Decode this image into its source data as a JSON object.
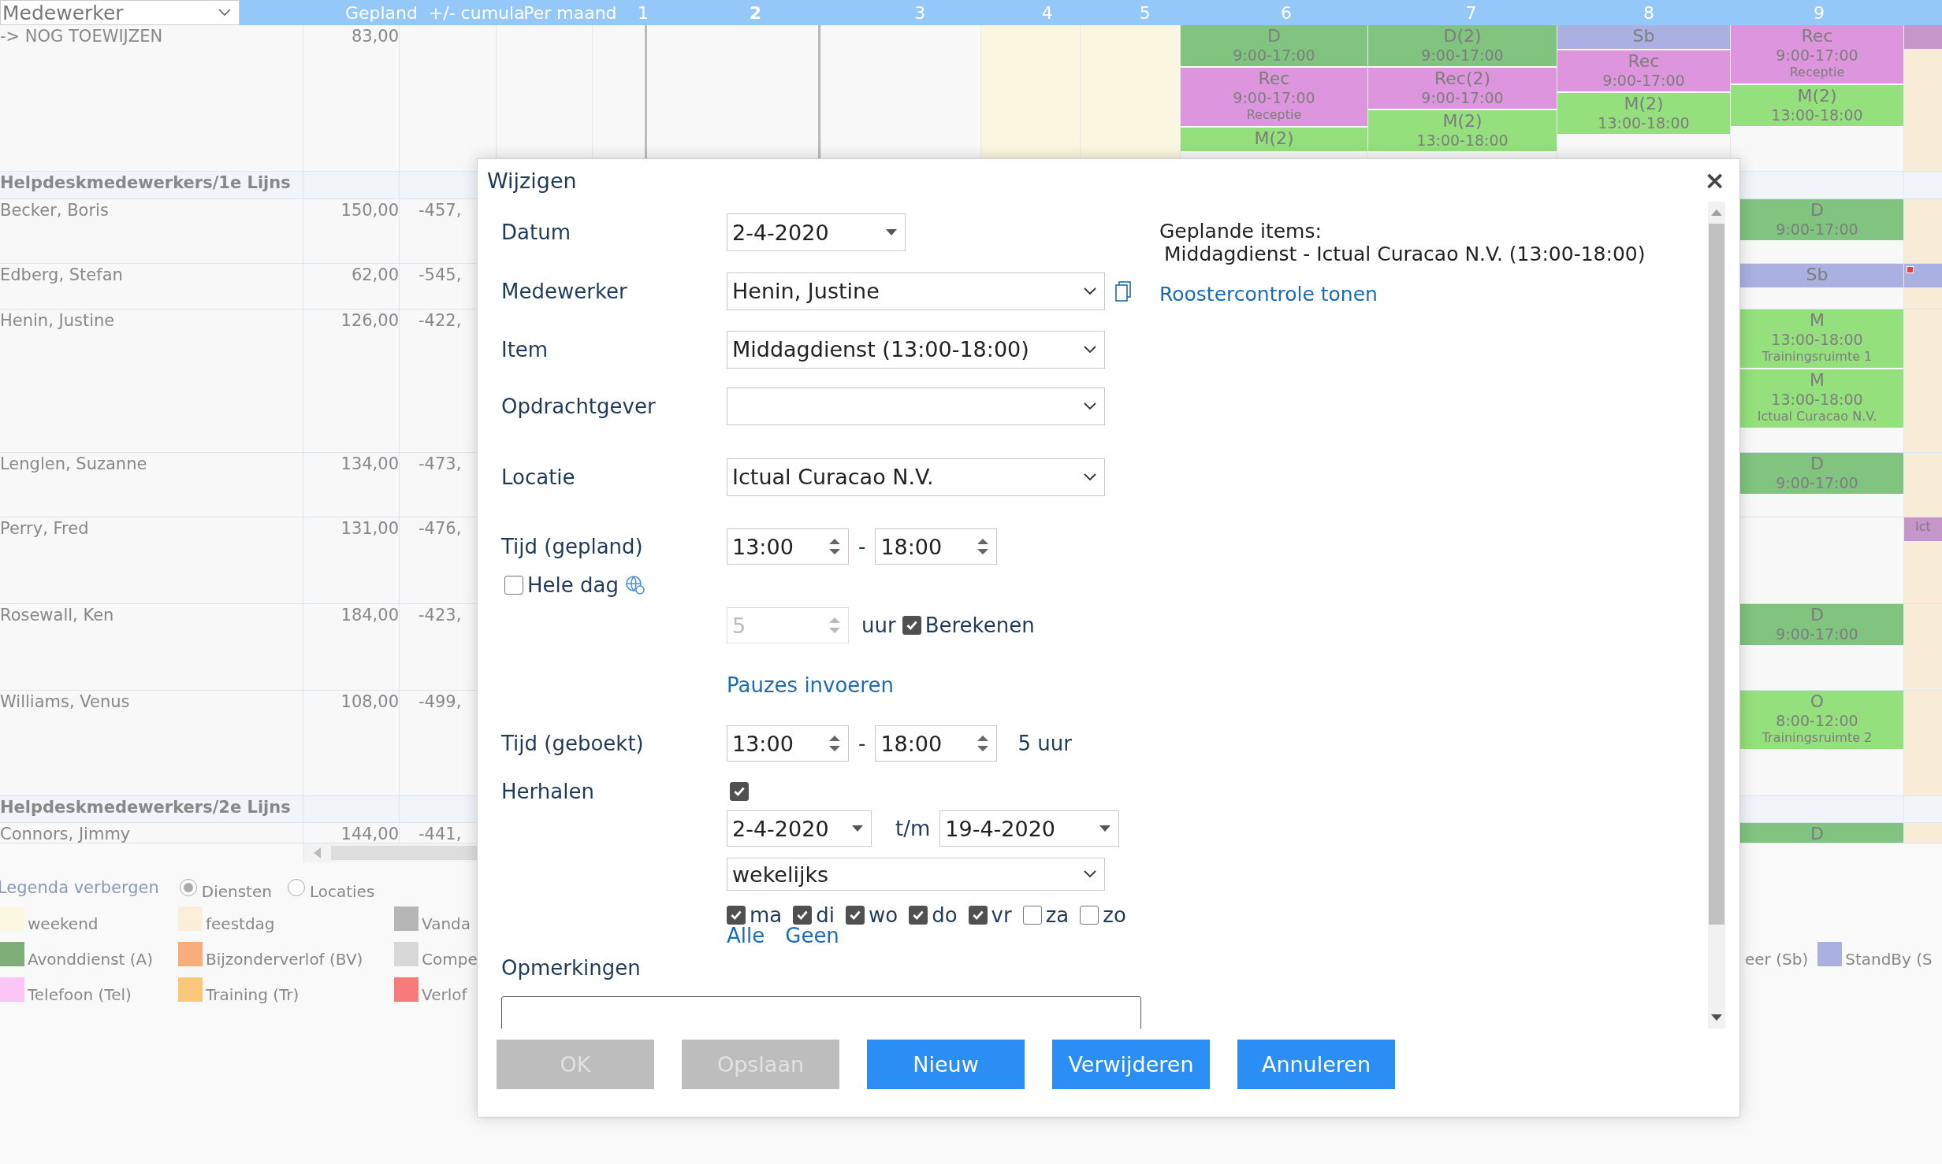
{
  "grid": {
    "employee_select": "Medewerker",
    "columns": [
      "Gepland",
      "+/- cumula",
      "Per maand"
    ],
    "days": [
      {
        "label": "1",
        "kind": "normal"
      },
      {
        "label": "2",
        "kind": "today"
      },
      {
        "label": "3",
        "kind": "normal"
      },
      {
        "label": "4",
        "kind": "weekend"
      },
      {
        "label": "5",
        "kind": "weekend"
      },
      {
        "label": "6",
        "kind": "normal"
      },
      {
        "label": "7",
        "kind": "normal"
      },
      {
        "label": "8",
        "kind": "normal"
      },
      {
        "label": "9",
        "kind": "normal"
      },
      {
        "kind": "holiday"
      }
    ],
    "rows": [
      {
        "kind": "employee",
        "name": "-> NOG TOEWIJZEN",
        "planned": "83,00",
        "cells": [
          {},
          {},
          {},
          {},
          {},
          {
            "shifts": [
              {
                "code": "D",
                "time": "9:00-17:00",
                "color": "#80c480"
              },
              {
                "code": "Rec",
                "time": "9:00-17:00",
                "place": "Receptie",
                "color": "#dd96dd"
              },
              {
                "code": "M(2)",
                "color": "#94e07c"
              }
            ]
          },
          {
            "shifts": [
              {
                "code": "D(2)",
                "time": "9:00-17:00",
                "color": "#80c480"
              },
              {
                "code": "Rec(2)",
                "time": "9:00-17:00",
                "color": "#dd96dd"
              },
              {
                "code": "M(2)",
                "time": "13:00-18:00",
                "color": "#94e07c"
              }
            ]
          },
          {
            "shifts": [
              {
                "code": "Sb",
                "color": "#aab0e0"
              },
              {
                "code": "Rec",
                "time": "9:00-17:00",
                "color": "#dd96dd"
              },
              {
                "code": "M(2)",
                "time": "13:00-18:00",
                "color": "#94e07c"
              }
            ]
          },
          {
            "shifts": [
              {
                "code": "Rec",
                "time": "9:00-17:00",
                "place": "Receptie",
                "color": "#dd96dd"
              },
              {
                "code": "M(2)",
                "time": "13:00-18:00",
                "color": "#94e07c"
              }
            ]
          },
          {
            "shifts": [
              {
                "color": "#c597c8"
              }
            ]
          }
        ]
      },
      {
        "kind": "group",
        "name": "Helpdeskmedewerkers/1e Lijns"
      },
      {
        "kind": "employee",
        "name": "Becker, Boris",
        "planned": "150,00",
        "cumulative": "-457,",
        "cells": [
          {},
          {},
          {},
          {},
          {},
          {},
          {},
          {},
          {
            "shifts": [
              {
                "code": "D",
                "time": "9:00-17:00",
                "color": "#80c480"
              }
            ]
          },
          {}
        ]
      },
      {
        "kind": "employee",
        "name": "Edberg, Stefan",
        "planned": "62,00",
        "cumulative": "-545,",
        "cells": [
          {},
          {},
          {},
          {},
          {},
          {},
          {},
          {},
          {
            "shifts": [
              {
                "code": "Sb",
                "color": "#aab0e0"
              }
            ]
          },
          {
            "shifts": [
              {
                "color": "#aab0e0",
                "flagged": true
              }
            ]
          }
        ]
      },
      {
        "kind": "employee",
        "name": "Henin, Justine",
        "planned": "126,00",
        "cumulative": "-422,",
        "cells": [
          {},
          {},
          {},
          {},
          {},
          {},
          {},
          {},
          {
            "shifts": [
              {
                "code": "M",
                "time": "13:00-18:00",
                "place": "Trainingsruimte 1",
                "color": "#94e07c"
              },
              {
                "code": "M",
                "time": "13:00-18:00",
                "place": "Ictual Curacao N.V.",
                "color": "#94e07c"
              }
            ]
          },
          {}
        ]
      },
      {
        "kind": "employee",
        "name": "Lenglen, Suzanne",
        "planned": "134,00",
        "cumulative": "-473,",
        "cells": [
          {},
          {},
          {},
          {},
          {},
          {},
          {},
          {},
          {
            "shifts": [
              {
                "code": "D",
                "time": "9:00-17:00",
                "color": "#80c480"
              }
            ]
          },
          {}
        ]
      },
      {
        "kind": "employee",
        "name": "Perry, Fred",
        "planned": "131,00",
        "cumulative": "-476,",
        "cells": [
          {},
          {},
          {},
          {},
          {},
          {},
          {},
          {},
          {},
          {
            "shifts": [
              {
                "place": "Ict",
                "color": "#c597c8"
              }
            ]
          }
        ]
      },
      {
        "kind": "employee",
        "name": "Rosewall, Ken",
        "planned": "184,00",
        "cumulative": "-423,",
        "cells": [
          {},
          {},
          {},
          {},
          {},
          {},
          {},
          {},
          {
            "shifts": [
              {
                "code": "D",
                "time": "9:00-17:00",
                "color": "#80c480"
              }
            ]
          },
          {}
        ]
      },
      {
        "kind": "employee",
        "name": "Williams, Venus",
        "planned": "108,00",
        "cumulative": "-499,",
        "cells": [
          {},
          {},
          {},
          {},
          {},
          {},
          {},
          {},
          {
            "shifts": [
              {
                "code": "O",
                "time": "8:00-12:00",
                "place": "Trainingsruimte 2",
                "color": "#94e07c"
              }
            ]
          },
          {}
        ]
      },
      {
        "kind": "group",
        "name": "Helpdeskmedewerkers/2e Lijns"
      },
      {
        "kind": "employee",
        "name": "Connors, Jimmy",
        "planned": "144,00",
        "cumulative": "-441,",
        "cells": [
          {},
          {},
          {},
          {},
          {},
          {},
          {},
          {},
          {
            "shifts": [
              {
                "code": "D",
                "color": "#80c480"
              }
            ]
          },
          {}
        ]
      }
    ]
  },
  "legend": {
    "toggle": "Legenda verbergen",
    "modes": [
      {
        "label": "Diensten",
        "selected": true
      },
      {
        "label": "Locaties",
        "selected": false
      }
    ],
    "items": [
      {
        "label": "weekend",
        "color": "#fbf8e2"
      },
      {
        "label": "Avonddienst (A)",
        "color": "#7fae79"
      },
      {
        "label": "Telefoon (Tel)",
        "color": "#fbc6f6"
      },
      {
        "label": "feestdag",
        "color": "#fbeedb"
      },
      {
        "label": "Bijzonderverlof (BV)",
        "color": "#f9ad7a"
      },
      {
        "label": "Training (Tr)",
        "color": "#fbc87a"
      },
      {
        "label": "Vanda",
        "color": "#b6b6b6"
      },
      {
        "label": "Compe",
        "color": "#d8d8d8"
      },
      {
        "label": "Verlof",
        "color": "#f77b7b"
      }
    ],
    "items_right": [
      {
        "label": "eer (Sb)"
      },
      {
        "label": "StandBy (S",
        "color": "#aab0e0"
      }
    ]
  },
  "dialog": {
    "title": "Wijzigen",
    "close": "×",
    "date": {
      "label": "Datum",
      "value": "2-4-2020"
    },
    "employee": {
      "label": "Medewerker",
      "value": "Henin, Justine"
    },
    "item": {
      "label": "Item",
      "value": "Middagdienst (13:00-18:00)"
    },
    "client": {
      "label": "Opdrachtgever"
    },
    "location": {
      "label": "Locatie",
      "value": "Ictual Curacao N.V."
    },
    "planned_time": {
      "label": "Tijd (gepland)",
      "from": "13:00",
      "separator": "-",
      "to": "18:00"
    },
    "whole_day": {
      "label": "Hele dag",
      "checked": false
    },
    "hours": {
      "value": "5",
      "unit": "uur",
      "disabled": true
    },
    "calculate": {
      "label": "Berekenen",
      "checked": true
    },
    "breaks_link": "Pauzes invoeren",
    "booked_time": {
      "label": "Tijd (geboekt)",
      "from": "13:00",
      "separator": "-",
      "to": "18:00",
      "total": "5 uur"
    },
    "repeat": {
      "label": "Herhalen",
      "checked": true,
      "from": "2-4-2020",
      "until_label": "t/m",
      "to": "19-4-2020",
      "frequency": "wekelijks",
      "weekdays": [
        {
          "label": "ma",
          "checked": true
        },
        {
          "label": "di",
          "checked": true
        },
        {
          "label": "wo",
          "checked": true
        },
        {
          "label": "do",
          "checked": true
        },
        {
          "label": "vr",
          "checked": true
        },
        {
          "label": "za",
          "checked": false
        },
        {
          "label": "zo",
          "checked": false
        }
      ],
      "select_all": "Alle",
      "select_none": "Geen"
    },
    "remarks": {
      "label": "Opmerkingen"
    },
    "info": {
      "heading": "Geplande items:",
      "items": [
        "Middagdienst - Ictual Curacao N.V. (13:00-18:00)"
      ],
      "link": "Roostercontrole tonen"
    },
    "buttons": [
      {
        "label": "OK",
        "disabled": true
      },
      {
        "label": "Opslaan",
        "disabled": true
      },
      {
        "label": "Nieuw",
        "disabled": false
      },
      {
        "label": "Verwijderen",
        "disabled": false
      },
      {
        "label": "Annuleren",
        "disabled": false
      }
    ]
  }
}
